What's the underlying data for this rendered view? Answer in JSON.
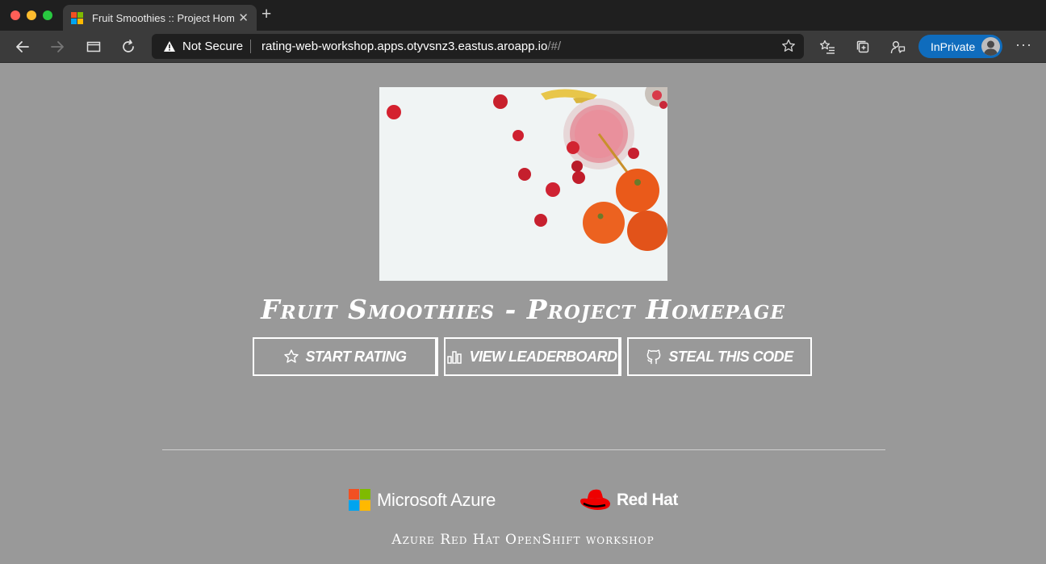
{
  "browser": {
    "tab_title": "Fruit Smoothies :: Project Homepage",
    "security_label": "Not Secure",
    "url_main": "rating-web-workshop.apps.otyvsnz3.eastus.aroapp.io",
    "url_tail": "/#/",
    "inprivate_label": "InPrivate",
    "more_label": "···",
    "new_tab_label": "+",
    "close_label": "✕"
  },
  "page": {
    "title": "Fruit Smoothies - Project Homepage",
    "buttons": [
      {
        "label": "Start Rating",
        "icon": "star-icon"
      },
      {
        "label": "View Leaderboard",
        "icon": "bar-chart-icon"
      },
      {
        "label": "Steal this code",
        "icon": "github-icon"
      }
    ],
    "sponsors": {
      "microsoft": "Microsoft Azure",
      "redhat": "Red Hat"
    },
    "footer": "Azure Red Hat OpenShift workshop"
  },
  "colors": {
    "page_bg": "#999999",
    "ms_red": "#f25022",
    "ms_green": "#7fba00",
    "ms_blue": "#00a4ef",
    "ms_yellow": "#ffb900",
    "redhat_red": "#ee0000",
    "inprivate_blue": "#0f6cbd"
  }
}
